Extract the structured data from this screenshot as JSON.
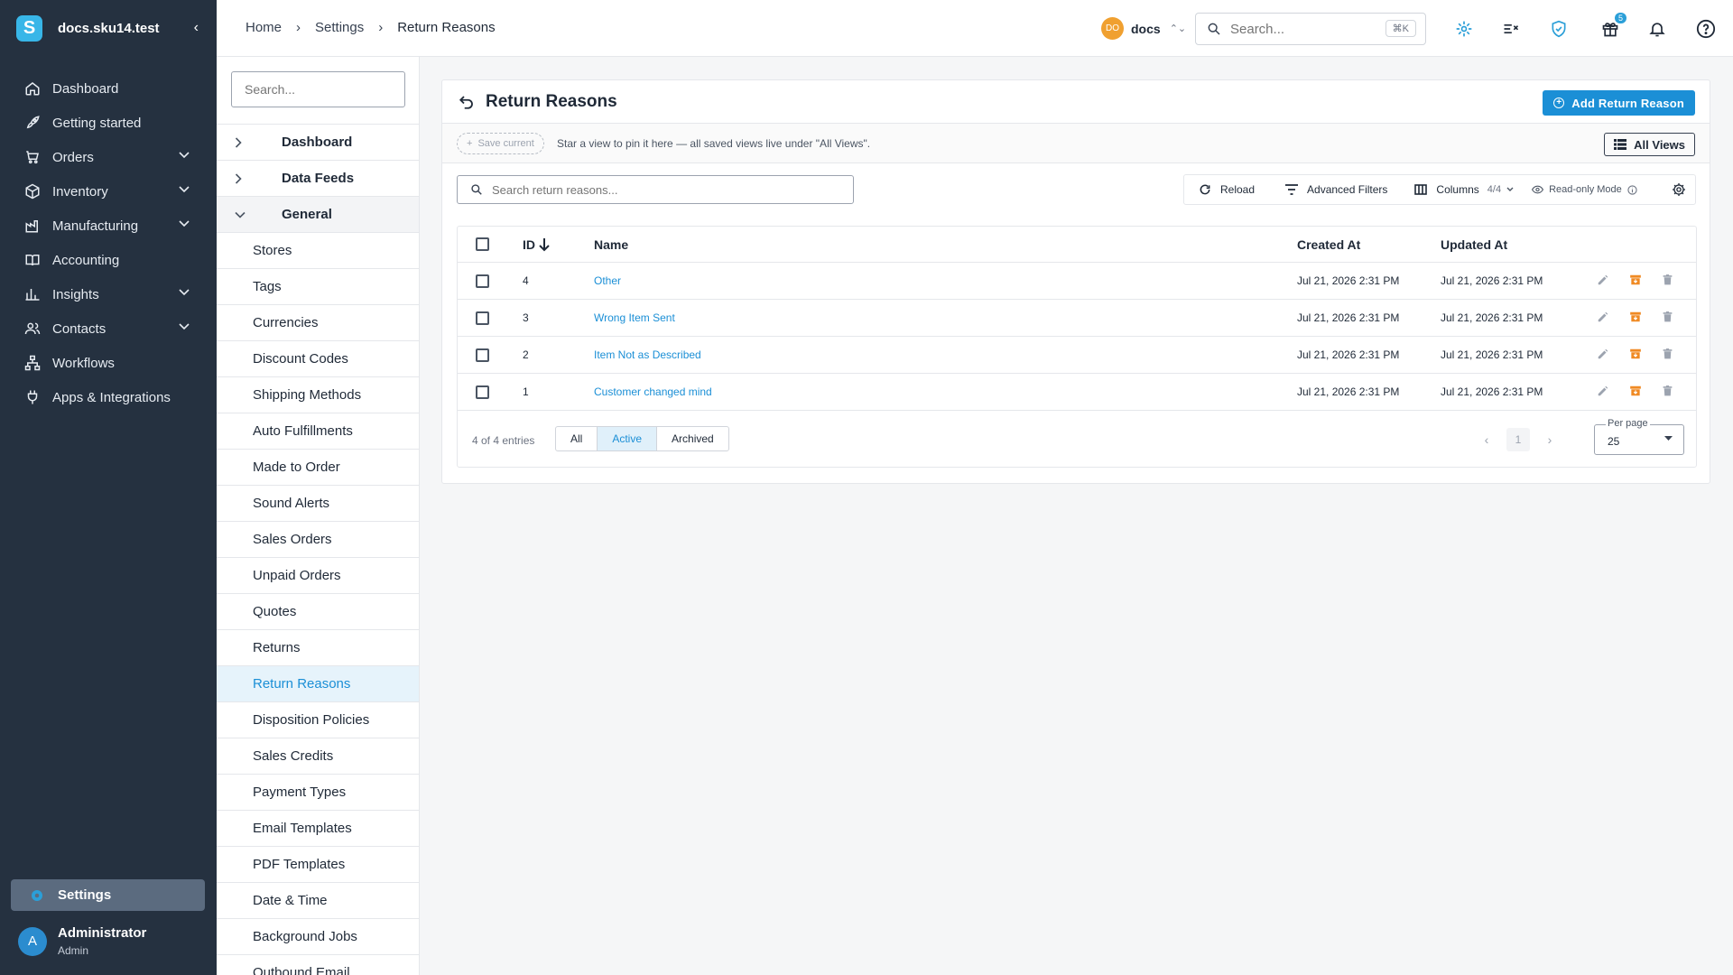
{
  "app": {
    "name": "docs.sku14.test",
    "logo_letter": "S"
  },
  "sidebar": {
    "items": [
      {
        "label": "Dashboard",
        "icon": "home-icon",
        "has_children": false
      },
      {
        "label": "Getting started",
        "icon": "rocket-icon",
        "has_children": false
      },
      {
        "label": "Orders",
        "icon": "cart-icon",
        "has_children": true
      },
      {
        "label": "Inventory",
        "icon": "box-icon",
        "has_children": true
      },
      {
        "label": "Manufacturing",
        "icon": "factory-icon",
        "has_children": true
      },
      {
        "label": "Accounting",
        "icon": "book-icon",
        "has_children": false
      },
      {
        "label": "Insights",
        "icon": "chart-icon",
        "has_children": true
      },
      {
        "label": "Contacts",
        "icon": "people-icon",
        "has_children": true
      },
      {
        "label": "Workflows",
        "icon": "hierarchy-icon",
        "has_children": false
      },
      {
        "label": "Apps & Integrations",
        "icon": "plug-icon",
        "has_children": false
      }
    ],
    "settings_label": "Settings",
    "user": {
      "initial": "A",
      "name": "Administrator",
      "role": "Admin"
    }
  },
  "topbar": {
    "breadcrumb": [
      "Home",
      "Settings",
      "Return Reasons"
    ],
    "store": {
      "initials": "DO",
      "name": "docs"
    },
    "search": {
      "placeholder": "Search...",
      "shortcut": "⌘K"
    },
    "gift_count": "5"
  },
  "subnav": {
    "search_placeholder": "Search...",
    "groups": [
      {
        "label": "Dashboard",
        "open": false
      },
      {
        "label": "Data Feeds",
        "open": false
      },
      {
        "label": "General",
        "open": true
      }
    ],
    "items": [
      "Stores",
      "Tags",
      "Currencies",
      "Discount Codes",
      "Shipping Methods",
      "Auto Fulfillments",
      "Made to Order",
      "Sound Alerts",
      "Sales Orders",
      "Unpaid Orders",
      "Quotes",
      "Returns",
      "Return Reasons",
      "Disposition Policies",
      "Sales Credits",
      "Payment Types",
      "Email Templates",
      "PDF Templates",
      "Date & Time",
      "Background Jobs",
      "Outbound Email"
    ],
    "active_item": "Return Reasons"
  },
  "page": {
    "title": "Return Reasons",
    "add_button": "Add Return Reason",
    "save_current": "Save current",
    "views_hint": "Star a view to pin it here — all saved views live under \"All Views\".",
    "all_views": "All Views",
    "table_search_placeholder": "Search return reasons...",
    "toolbar": {
      "reload": "Reload",
      "advanced_filters": "Advanced Filters",
      "columns": "Columns",
      "columns_count": "4/4",
      "read_only": "Read-only Mode"
    },
    "table": {
      "columns": [
        "ID",
        "Name",
        "Created At",
        "Updated At"
      ],
      "sort": {
        "column": "ID",
        "direction": "desc"
      },
      "rows": [
        {
          "id": "4",
          "name": "Other",
          "created": "Jul 21, 2026 2:31 PM",
          "updated": "Jul 21, 2026 2:31 PM"
        },
        {
          "id": "3",
          "name": "Wrong Item Sent",
          "created": "Jul 21, 2026 2:31 PM",
          "updated": "Jul 21, 2026 2:31 PM"
        },
        {
          "id": "2",
          "name": "Item Not as Described",
          "created": "Jul 21, 2026 2:31 PM",
          "updated": "Jul 21, 2026 2:31 PM"
        },
        {
          "id": "1",
          "name": "Customer changed mind",
          "created": "Jul 21, 2026 2:31 PM",
          "updated": "Jul 21, 2026 2:31 PM"
        }
      ]
    },
    "footer": {
      "entries": "4 of 4 entries",
      "filters": [
        "All",
        "Active",
        "Archived"
      ],
      "active_filter": "Active",
      "page": "1",
      "per_page_label": "Per page",
      "per_page_value": "25"
    }
  },
  "colors": {
    "sidebar_bg": "#253140",
    "accent": "#1b8fd6",
    "archive": "#f08a24"
  }
}
